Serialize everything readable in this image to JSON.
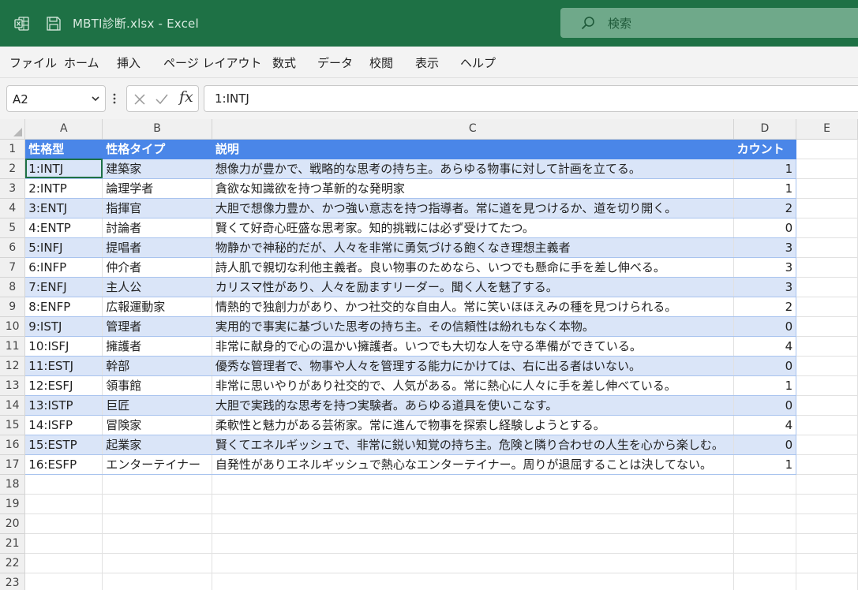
{
  "titlebar": {
    "title": "MBTI診断.xlsx  -  Excel",
    "search_placeholder": "検索",
    "bg_color": "#1e7145"
  },
  "menu": [
    "ファイル",
    "ホーム",
    "挿入",
    "ページ レイアウト",
    "数式",
    "データ",
    "校閲",
    "表示",
    "ヘルプ"
  ],
  "formula_bar": {
    "name_box": "A2",
    "fx_label": "fx",
    "formula": "1:INTJ"
  },
  "sheet": {
    "columns": [
      "A",
      "B",
      "C",
      "D",
      "E"
    ],
    "rows": [
      "1",
      "2",
      "3",
      "4",
      "5",
      "6",
      "7",
      "8",
      "9",
      "10",
      "11",
      "12",
      "13",
      "14",
      "15",
      "16",
      "17",
      "18",
      "19",
      "20",
      "21",
      "22",
      "23"
    ],
    "table_header": [
      "性格型",
      "性格タイプ",
      "説明",
      "カウント"
    ],
    "table_rows": [
      [
        "1:INTJ",
        "建築家",
        "想像力が豊かで、戦略的な思考の持ち主。あらゆる物事に対して計画を立てる。",
        "1"
      ],
      [
        "2:INTP",
        "論理学者",
        "貪欲な知識欲を持つ革新的な発明家",
        "1"
      ],
      [
        "3:ENTJ",
        "指揮官",
        "大胆で想像力豊か、かつ強い意志を持つ指導者。常に道を見つけるか、道を切り開く。",
        "2"
      ],
      [
        "4:ENTP",
        "討論者",
        "賢くて好奇心旺盛な思考家。知的挑戦には必ず受けてたつ。",
        "0"
      ],
      [
        "5:INFJ",
        "提唱者",
        "物静かで神秘的だが、人々を非常に勇気づける飽くなき理想主義者",
        "3"
      ],
      [
        "6:INFP",
        "仲介者",
        "詩人肌で親切な利他主義者。良い物事のためなら、いつでも懸命に手を差し伸べる。",
        "3"
      ],
      [
        "7:ENFJ",
        "主人公",
        "カリスマ性があり、人々を励ますリーダー。聞く人を魅了する。",
        "3"
      ],
      [
        "8:ENFP",
        "広報運動家",
        "情熱的で独創力があり、かつ社交的な自由人。常に笑いほほえみの種を見つけられる。",
        "2"
      ],
      [
        "9:ISTJ",
        "管理者",
        "実用的で事実に基づいた思考の持ち主。その信頼性は紛れもなく本物。",
        "0"
      ],
      [
        "10:ISFJ",
        "擁護者",
        "非常に献身的で心の温かい擁護者。いつでも大切な人を守る準備ができている。",
        "4"
      ],
      [
        "11:ESTJ",
        "幹部",
        "優秀な管理者で、物事や人々を管理する能力にかけては、右に出る者はいない。",
        "0"
      ],
      [
        "12:ESFJ",
        "領事館",
        "非常に思いやりがあり社交的で、人気がある。常に熱心に人々に手を差し伸べている。",
        "1"
      ],
      [
        "13:ISTP",
        "巨匠",
        "大胆で実践的な思考を持つ実験者。あらゆる道具を使いこなす。",
        "0"
      ],
      [
        "14:ISFP",
        "冒険家",
        "柔軟性と魅力がある芸術家。常に進んで物事を探索し経験しようとする。",
        "4"
      ],
      [
        "15:ESTP",
        "起業家",
        "賢くてエネルギッシュで、非常に鋭い知覚の持ち主。危険と隣り合わせの人生を心から楽しむ。",
        "0"
      ],
      [
        "16:ESFP",
        "エンターテイナー",
        "自発性がありエネルギッシュで熱心なエンターテイナー。周りが退屈することは決してない。",
        "1"
      ]
    ],
    "table_header_color": "#4a86e8",
    "band_color": "#dae5f8"
  }
}
